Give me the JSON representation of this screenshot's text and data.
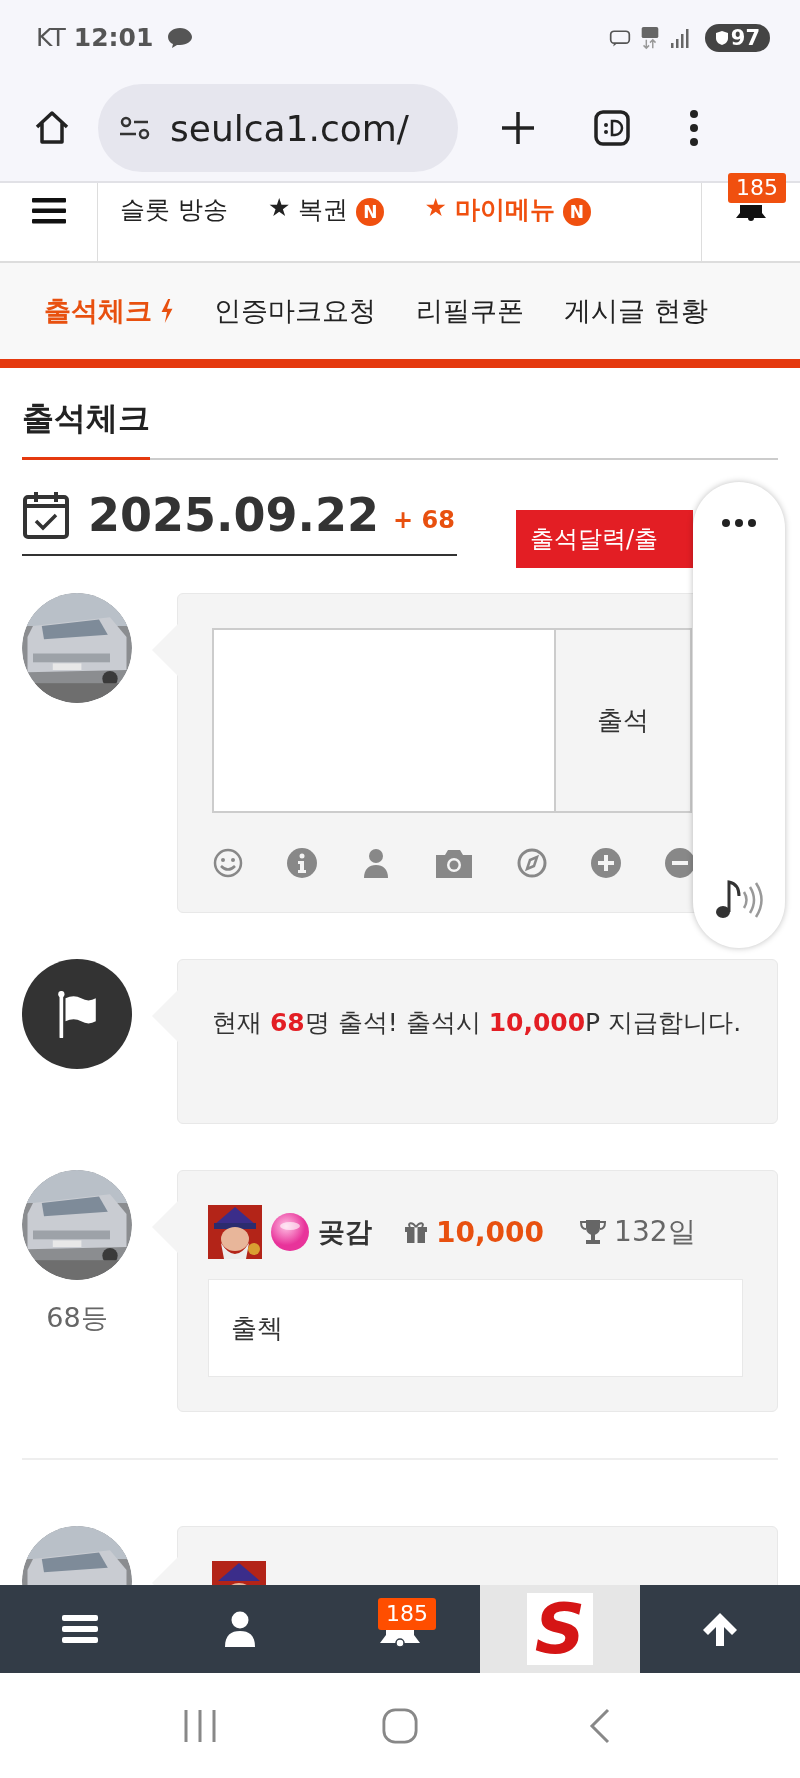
{
  "status_bar": {
    "carrier": "KT",
    "time": "12:01",
    "battery": "97"
  },
  "browser": {
    "url": "seulca1.com/"
  },
  "top_nav": {
    "items": [
      {
        "label": "슬롯 방송",
        "highlight": false
      },
      {
        "prefix": "★",
        "label": "복권",
        "highlight": false,
        "badge": "N"
      },
      {
        "prefix": "★",
        "label": "마이메뉴",
        "highlight": true,
        "badge": "N"
      }
    ],
    "notification_count": "185"
  },
  "sub_tabs": [
    {
      "label": "출석체크",
      "selected": true
    },
    {
      "label": "인증마크요청",
      "selected": false
    },
    {
      "label": "리필쿠폰",
      "selected": false
    },
    {
      "label": "게시글 현황",
      "selected": false
    }
  ],
  "page_title": "출석체크",
  "date": "2025.09.22",
  "date_count": "+ 68",
  "calendar_button": "출석달력/출",
  "compose": {
    "submit": "출석"
  },
  "notice": "현재 **68**명 출석! 출석시 **10,000**P 지급합니다.",
  "comments": [
    {
      "rank": "68등",
      "name": "곶감",
      "points": "10,000",
      "days": "132일",
      "text": "출첵"
    }
  ],
  "bottom_bar": {
    "notification_count": "185",
    "logo": "S"
  }
}
